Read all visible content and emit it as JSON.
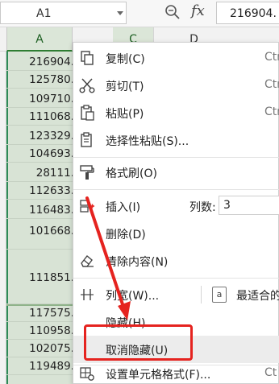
{
  "formula_bar": {
    "cell_ref": "A1",
    "formula_value": "216904.",
    "fx_label": "fx",
    "zoom_icon": "zoom-icon"
  },
  "columns": {
    "a": "A",
    "c": "C",
    "d": "D"
  },
  "cells": [
    "216904.",
    "125780.",
    "109710.",
    "111068.",
    "123329.",
    "104693.",
    "28111.",
    "112633.",
    "116483.",
    "101668.",
    "111851.",
    "117575.",
    "110958.",
    "102075.",
    "119489."
  ],
  "menu": {
    "copy": {
      "label": "复制(C)",
      "shortcut": "Ctr",
      "icon": "copy-icon"
    },
    "cut": {
      "label": "剪切(T)",
      "shortcut": "Ctr",
      "icon": "scissors-icon"
    },
    "paste": {
      "label": "粘贴(P)",
      "shortcut": "Ctr",
      "icon": "paste-icon"
    },
    "paste_special": {
      "label": "选择性粘贴(S)...",
      "icon": "paste-special-icon"
    },
    "format_painter": {
      "label": "格式刷(O)",
      "icon": "format-painter-icon"
    },
    "insert": {
      "label": "插入(I)",
      "col_count_label": "列数:",
      "col_count_value": "3",
      "icon": "insert-column-icon"
    },
    "delete": {
      "label": "删除(D)"
    },
    "clear": {
      "label": "清除内容(N)",
      "icon": "eraser-icon"
    },
    "col_width": {
      "label": "列宽(W)...",
      "fit_label": "最适合的",
      "fit_icon_text": "a",
      "icon": "column-width-icon"
    },
    "hide": {
      "label": "隐藏(H)"
    },
    "unhide": {
      "label": "取消隐藏(U)"
    },
    "format_cells": {
      "label": "设置单元格格式(F)...",
      "shortcut": "Ct",
      "icon": "format-cells-icon"
    }
  },
  "colors": {
    "accent": "#2e7d32",
    "annotation": "#e5231f",
    "selection": "#d8e3d5"
  }
}
